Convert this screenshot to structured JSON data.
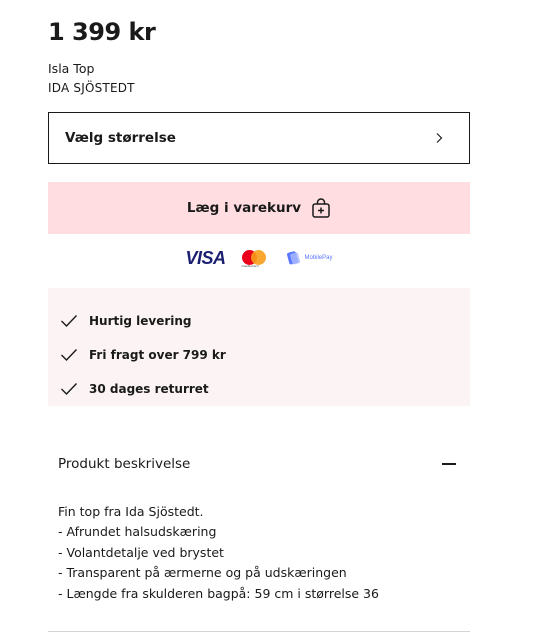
{
  "product": {
    "price": "1 399 kr",
    "name": "Isla Top",
    "brand": "IDA SJÖSTEDT"
  },
  "size_select": {
    "label": "Vælg størrelse",
    "icon": "chevron-right-icon"
  },
  "add_to_cart": {
    "label": "Læg i varekurv",
    "icon": "shopping-bag-plus-icon",
    "background": "#ffdde1"
  },
  "payments": {
    "visa": "VISA",
    "mastercard": "mastercard",
    "mobilepay": "MobilePay"
  },
  "benefits": [
    {
      "text": "Hurtig levering",
      "icon": "check-icon"
    },
    {
      "text": "Fri fragt over 799 kr",
      "icon": "check-icon"
    },
    {
      "text": "30 dages returret",
      "icon": "check-icon"
    }
  ],
  "description": {
    "title": "Produkt beskrivelse",
    "toggle_icon": "minus-icon",
    "lines": [
      "Fin top fra Ida Sjöstedt.",
      "- Afrundet halsudskæring",
      "- Volantdetalje ved brystet",
      "- Transparent på ærmerne og på udskæringen",
      "- Længde fra skulderen bagpå: 59 cm i størrelse 36"
    ]
  }
}
